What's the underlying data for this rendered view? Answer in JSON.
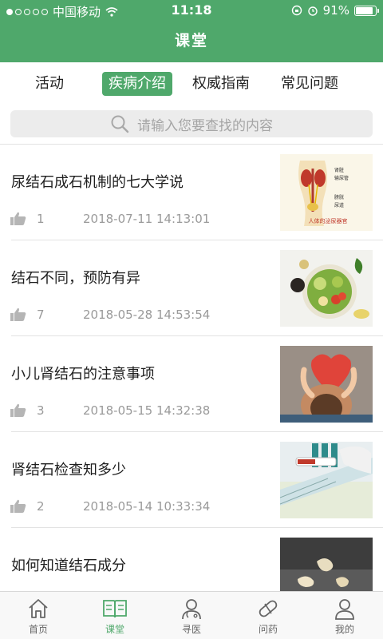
{
  "status": {
    "carrier": "中国移动",
    "time": "11:18",
    "battery": "91%",
    "battery_level": 0.91
  },
  "header": {
    "title": "课堂"
  },
  "tabs": [
    {
      "label": "活动",
      "active": false
    },
    {
      "label": "疾病介绍",
      "active": true
    },
    {
      "label": "权威指南",
      "active": false
    },
    {
      "label": "常见问题",
      "active": false
    }
  ],
  "search": {
    "placeholder": "请输入您要查找的内容"
  },
  "articles": [
    {
      "title": "尿结石成石机制的七大学说",
      "likes": "1",
      "date": "2018-07-11 14:13:01",
      "thumb_caption": "人体的泌尿器官",
      "thumb_labels": [
        "肾脏",
        "输尿管",
        "膀胱",
        "尿道"
      ]
    },
    {
      "title": "结石不同，预防有异",
      "likes": "7",
      "date": "2018-05-28 14:53:54"
    },
    {
      "title": "小儿肾结石的注意事项",
      "likes": "3",
      "date": "2018-05-15 14:32:38"
    },
    {
      "title": "肾结石检查知多少",
      "likes": "2",
      "date": "2018-05-14 10:33:34"
    },
    {
      "title": "如何知道结石成分"
    }
  ],
  "bottom_nav": [
    {
      "label": "首页",
      "icon": "home-icon",
      "active": false
    },
    {
      "label": "课堂",
      "icon": "book-icon",
      "active": true
    },
    {
      "label": "寻医",
      "icon": "doctor-icon",
      "active": false
    },
    {
      "label": "问药",
      "icon": "pill-icon",
      "active": false
    },
    {
      "label": "我的",
      "icon": "user-icon",
      "active": false
    }
  ],
  "colors": {
    "brand": "#4fa86b",
    "text": "#1e1e1e",
    "muted": "#9a9a9a"
  }
}
